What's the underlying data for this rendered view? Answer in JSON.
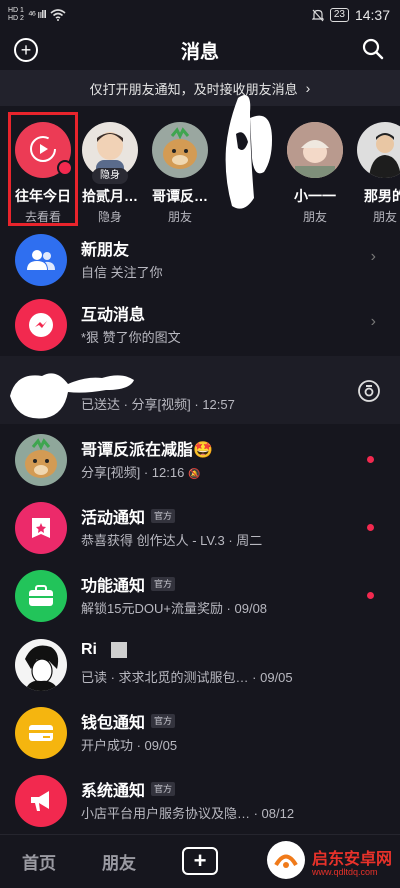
{
  "status_bar": {
    "sim1": "HD 1",
    "sim2": "HD 2",
    "signal": "⁴⁶ ıılll",
    "wifi": "wifi-icon",
    "battery": "23",
    "time": "14:37"
  },
  "header": {
    "title": "消息",
    "add_icon": "plus-circle-icon",
    "search_icon": "search-icon"
  },
  "notice": {
    "text": "仅打开朋友通知，及时接收朋友消息",
    "chevron": "›"
  },
  "stories": [
    {
      "name": "往年今日",
      "sub": "去看看"
    },
    {
      "name": "拾贰月…",
      "sub": "隐身",
      "tag": "隐身"
    },
    {
      "name": "哥谭反…",
      "sub": "朋友"
    },
    {
      "name": "",
      "sub": ""
    },
    {
      "name": "小一一",
      "sub": "朋友"
    },
    {
      "name": "那男的",
      "sub": "朋友"
    }
  ],
  "rows": [
    {
      "title": "新朋友",
      "sub": "自信 关注了你",
      "chevron": "›",
      "color": "#2f6ff0"
    },
    {
      "title": "互动消息",
      "sub": "*狠 赞了你的图文",
      "chevron": "›",
      "color": "#f2294f"
    },
    {
      "title": "",
      "sub": "已送达 · 分享[视频] · 12:57"
    },
    {
      "title": "哥谭反派在减脂🤩",
      "sub": "分享[视频] · 12:16"
    },
    {
      "title": "活动通知",
      "official": "官方",
      "sub": "恭喜获得  创作达人 - LV.3 · 周二",
      "color": "#ec2a6a"
    },
    {
      "title": "功能通知",
      "official": "官方",
      "sub": "解锁15元DOU+流量奖励 · 09/08",
      "color": "#22c45a"
    },
    {
      "title": "Ri",
      "sub": "已读 · 求求北觅的测试服包… · 09/05"
    },
    {
      "title": "钱包通知",
      "official": "官方",
      "sub": "开户成功 · 09/05",
      "color": "#f5b50f"
    },
    {
      "title": "系统通知",
      "official": "官方",
      "sub": "小店平台用户服务协议及隐… · 08/12",
      "color": "#f2294f"
    }
  ],
  "tabbar": {
    "home": "首页",
    "friends": "朋友",
    "plus": "+"
  },
  "watermark": {
    "brand": "启东安卓网",
    "url": "www.qdltdq.com"
  }
}
